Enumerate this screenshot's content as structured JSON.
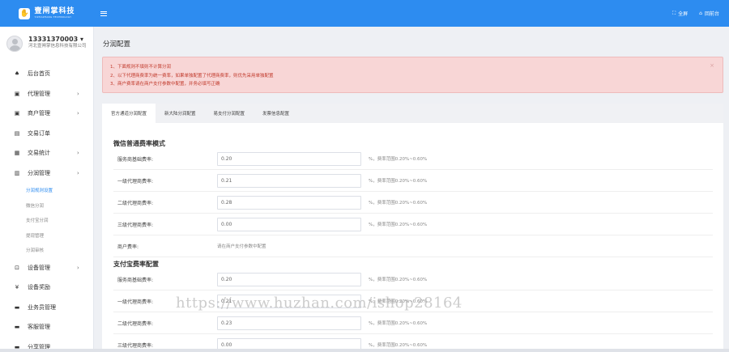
{
  "header": {
    "logo_cn": "壹闸掌科技",
    "logo_en": "YIZHAZHANG TECHNOLOGY",
    "fullscreen": "全屏",
    "home": "回前台"
  },
  "user": {
    "phone": "13331370003",
    "company": "河北壹闸掌信息科技有限公司"
  },
  "nav": {
    "items": [
      {
        "label": "后台首页",
        "icon": "home-icon"
      },
      {
        "label": "代理管理",
        "icon": "agent-icon"
      },
      {
        "label": "商户管理",
        "icon": "merchant-icon"
      },
      {
        "label": "交易订单",
        "icon": "order-icon"
      },
      {
        "label": "交易统计",
        "icon": "stats-icon"
      },
      {
        "label": "分润管理",
        "icon": "profit-icon"
      }
    ],
    "sub_items": [
      "分润规则设置",
      "微信分润",
      "支付宝分润",
      "提现管理",
      "分润审核"
    ],
    "items_bottom": [
      {
        "label": "设备管理",
        "icon": "device-icon"
      },
      {
        "label": "设备奖励",
        "icon": "yen-icon"
      },
      {
        "label": "业务员管理",
        "icon": "staff-icon"
      },
      {
        "label": "客服管理",
        "icon": "support-icon"
      },
      {
        "label": "分享管理",
        "icon": "share-icon"
      }
    ]
  },
  "page": {
    "title": "分润配置",
    "alert_lines": [
      "1、下面规则不填则不计算分润",
      "2、以下代理商费率为统一费率，如果单独配置了代理商费率，则优先采用单独配置",
      "3、商户费率请在商户支付参数中配置，并务必填写正确"
    ],
    "tabs": [
      "官方通道分润配置",
      "新大陆分润配置",
      "易支付分润配置",
      "发票信息配置"
    ]
  },
  "wechat": {
    "title": "微信普通费率模式",
    "rows": [
      {
        "label": "服务商基础费率:",
        "value": "0.20",
        "hint": "%，费率范围0.20%~0.60%"
      },
      {
        "label": "一级代理商费率:",
        "value": "0.21",
        "hint": "%，费率范围0.20%~0.60%"
      },
      {
        "label": "二级代理商费率:",
        "value": "0.28",
        "hint": "%，费率范围0.20%~0.60%"
      },
      {
        "label": "三级代理商费率:",
        "value": "0.00",
        "hint": "%，费率范围0.20%~0.60%"
      }
    ],
    "merchant_label": "商户费率:",
    "merchant_note": "请在商户支付参数中配置"
  },
  "alipay": {
    "title": "支付宝费率配置",
    "rows": [
      {
        "label": "服务商基础费率:",
        "value": "0.20",
        "hint": "%，费率范围0.20%~0.60%"
      },
      {
        "label": "一级代理商费率:",
        "value": "0.21",
        "hint": "%，费率范围0.20%~0.60%"
      },
      {
        "label": "二级代理商费率:",
        "value": "0.23",
        "hint": "%，费率范围0.20%~0.60%"
      },
      {
        "label": "三级代理商费率:",
        "value": "0.00",
        "hint": "%，费率范围0.20%~0.60%"
      }
    ]
  },
  "watermark": "https://www.huzhan.com/ishop28164",
  "colors": {
    "primary": "#2d8cf0",
    "alert_bg": "#f8d6d6",
    "alert_text": "#c0392b"
  }
}
